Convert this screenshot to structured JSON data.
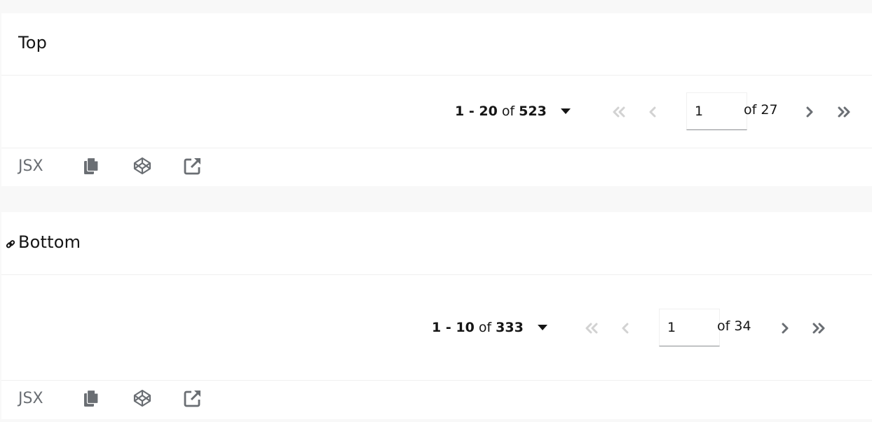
{
  "examples": [
    {
      "title": "Top",
      "pagination": {
        "range_start": "1",
        "range_sep": " - ",
        "range_end": "20",
        "of_label": "of",
        "total_items": "523",
        "page_value": "1",
        "of_pages": "of 27"
      },
      "toolbar": {
        "lang_label": "JSX"
      }
    },
    {
      "title": "Bottom",
      "pagination": {
        "range_start": "1",
        "range_sep": " - ",
        "range_end": "10",
        "of_label": "of",
        "total_items": "333",
        "page_value": "1",
        "of_pages": "of 34"
      },
      "toolbar": {
        "lang_label": "JSX"
      }
    }
  ],
  "colors": {
    "page_bg": "#f8f8f8",
    "card_bg": "#ffffff",
    "icon_enabled": "#6a6e73",
    "icon_disabled": "#d2d2d2",
    "text": "#151515"
  },
  "icons": {
    "first_page": "angle-double-left-icon",
    "prev_page": "angle-left-icon",
    "next_page": "angle-right-icon",
    "last_page": "angle-double-right-icon",
    "copy": "copy-icon",
    "codepen": "codepen-icon",
    "open_new": "external-link-icon",
    "anchor": "link-icon"
  }
}
